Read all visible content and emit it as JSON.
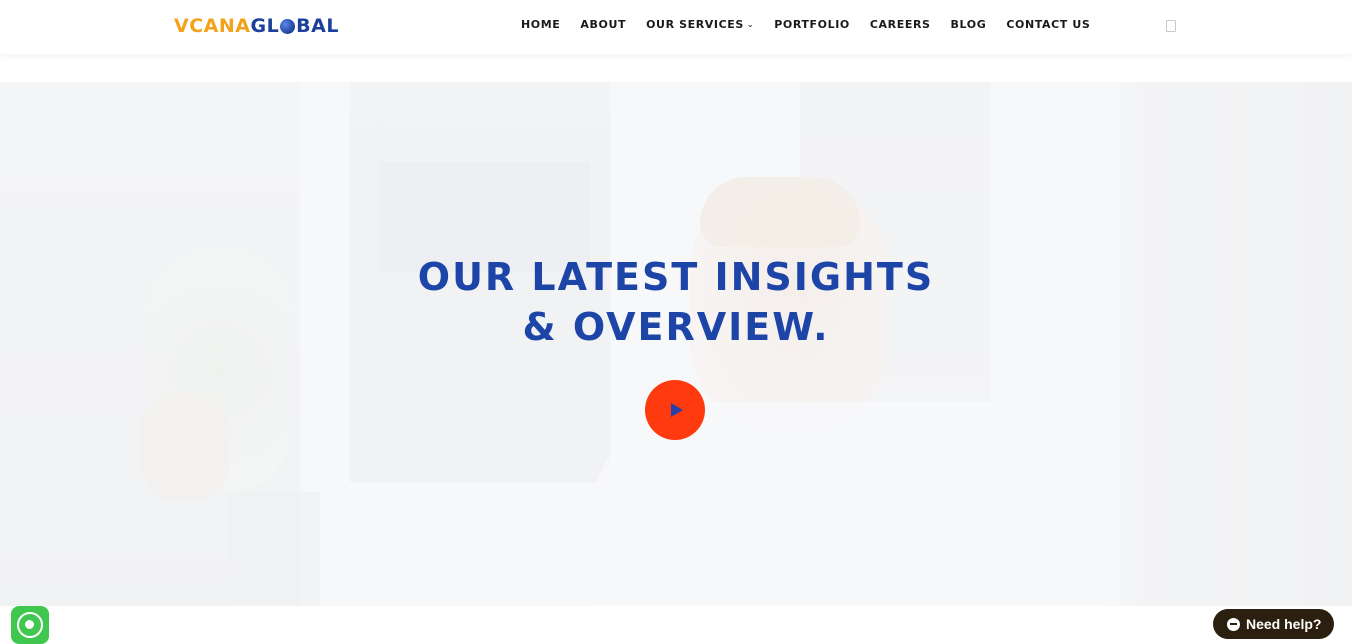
{
  "logo": {
    "part1": "VCANA",
    "part2a": "GL",
    "part2b": "BAL"
  },
  "nav": {
    "items": [
      {
        "label": "HOME"
      },
      {
        "label": "ABOUT"
      },
      {
        "label": "OUR SERVICES",
        "has_dropdown": true
      },
      {
        "label": "PORTFOLIO"
      },
      {
        "label": "CAREERS"
      },
      {
        "label": "BLOG"
      },
      {
        "label": "CONTACT US"
      }
    ],
    "dropdown_icon": "chevron-down-icon",
    "search_icon": "search-icon"
  },
  "hero": {
    "title_line1": "OUR LATEST INSIGHTS",
    "title_line2": "& OVERVIEW.",
    "play_icon": "play-icon"
  },
  "widgets": {
    "whatsapp_icon": "whatsapp-icon",
    "help_label": "Need help?",
    "help_icon": "chat-icon"
  },
  "colors": {
    "accent_blue": "#1d45a7",
    "logo_orange": "#f2a31b",
    "play_red": "#ff3a0f",
    "whatsapp_green": "#3fc74f",
    "help_bg": "#2b1f0f"
  }
}
